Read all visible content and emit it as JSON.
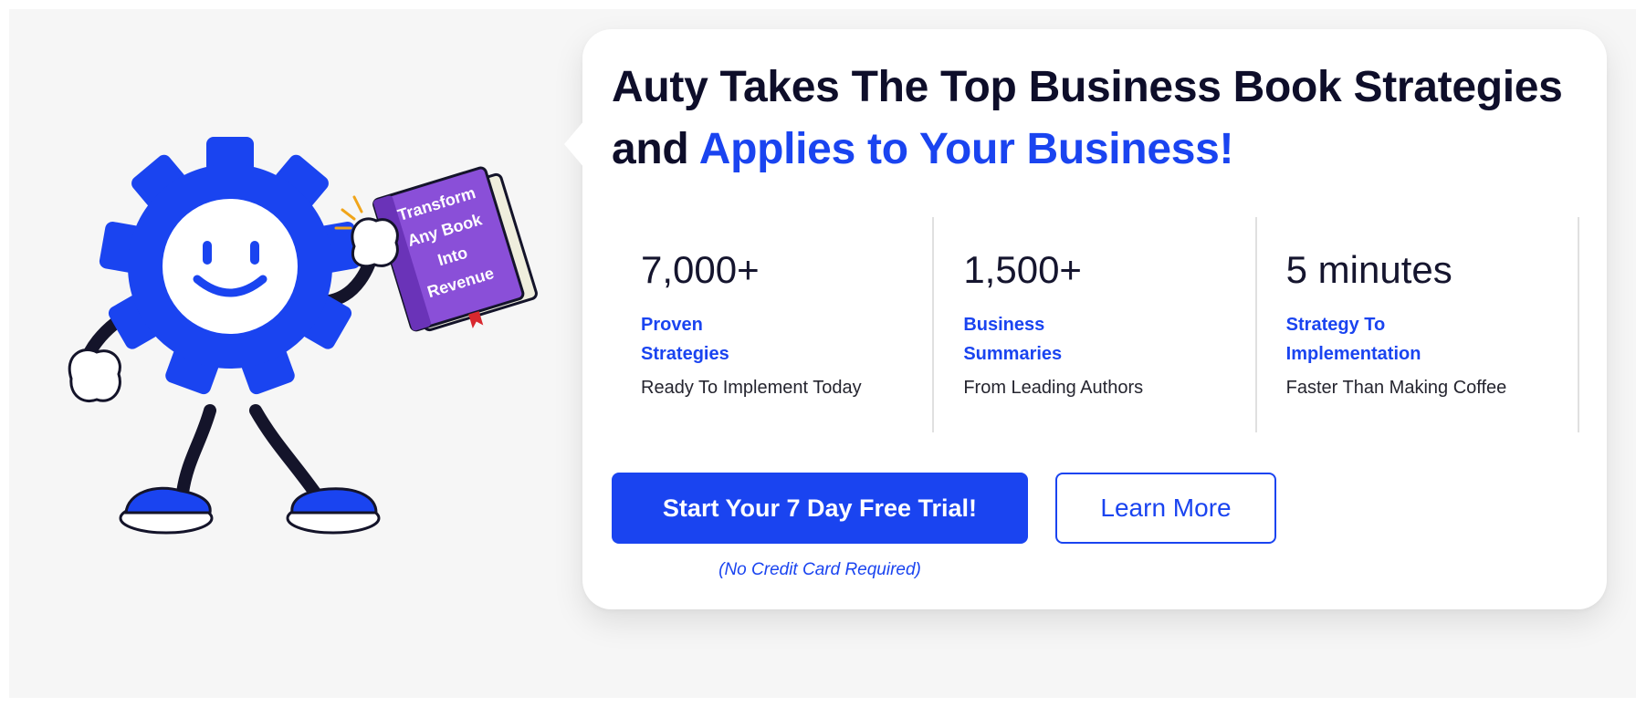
{
  "mascot": {
    "book_lines": [
      "Transform",
      "Any Book",
      "Into",
      "Revenue"
    ]
  },
  "headline": {
    "part1": "Auty Takes The Top Business Book Strategies and ",
    "highlight": "Applies to Your Business!"
  },
  "stats": [
    {
      "value": "7,000+",
      "title": "Proven\nStrategies",
      "subtitle": "Ready To Implement Today"
    },
    {
      "value": "1,500+",
      "title": "Business\nSummaries",
      "subtitle": "From Leading Authors"
    },
    {
      "value": "5 minutes",
      "title": "Strategy To\nImplementation",
      "subtitle": "Faster Than Making Coffee"
    }
  ],
  "cta": {
    "primary_label": "Start Your 7 Day Free Trial!",
    "secondary_label": "Learn More",
    "note": "(No Credit Card Required)"
  },
  "colors": {
    "accent": "#1a44f0",
    "text_dark": "#0e0e2a",
    "book_purple": "#8a4fd8",
    "mascot_outline": "#14142a"
  }
}
